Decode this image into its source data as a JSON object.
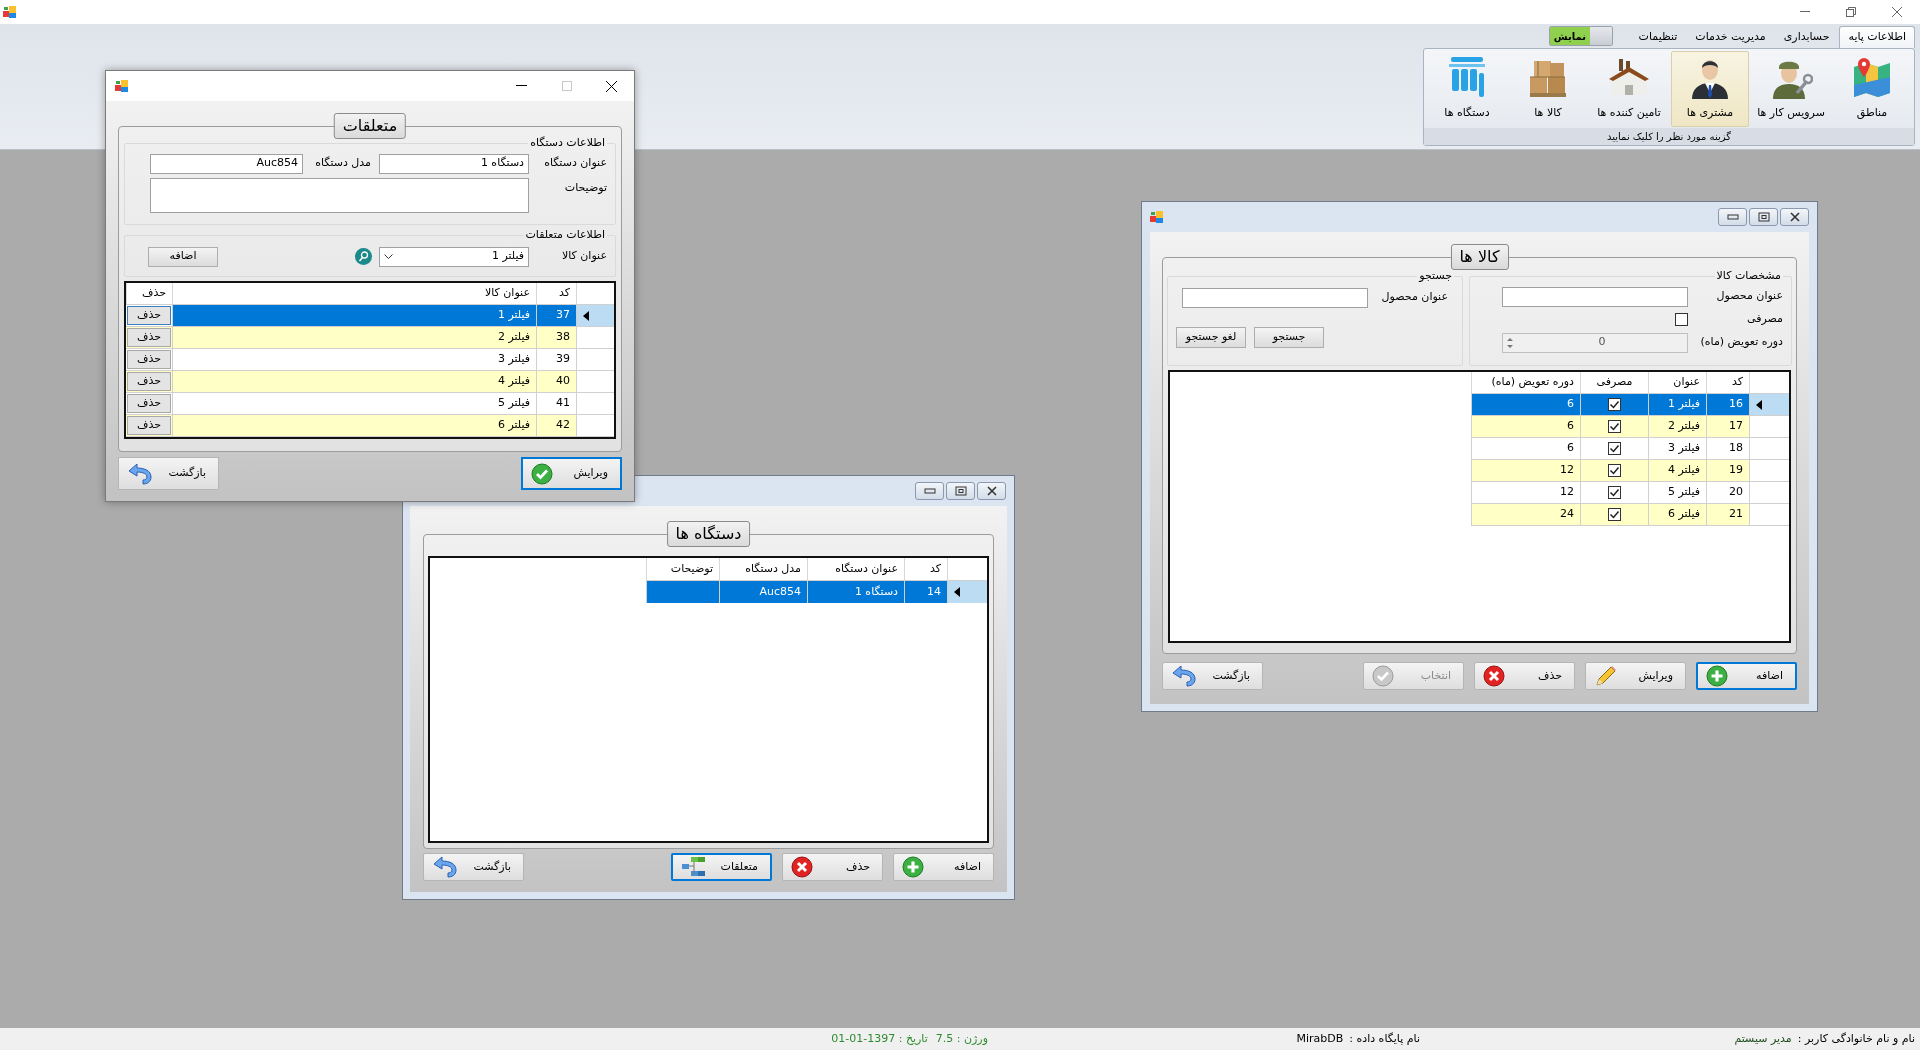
{
  "ribbon": {
    "tabs": [
      {
        "label": "اطلاعات پایه",
        "selected": true
      },
      {
        "label": "حسابداری",
        "selected": false
      },
      {
        "label": "مدیریت خدمات",
        "selected": false
      },
      {
        "label": "تنظیمات",
        "selected": false
      }
    ],
    "display_toggle": {
      "label": "نمایش",
      "on": true
    },
    "buttons": [
      {
        "label": "مناطق",
        "kind": "map",
        "selected": false
      },
      {
        "label": "سرویس کار ها",
        "kind": "worker",
        "selected": false
      },
      {
        "label": "مشتری ها",
        "kind": "customer",
        "selected": true
      },
      {
        "label": "تامین کننده ها",
        "kind": "supplier",
        "selected": false
      },
      {
        "label": "کالا ها",
        "kind": "goods",
        "selected": false
      },
      {
        "label": "دستگاه ها",
        "kind": "devices",
        "selected": false
      }
    ],
    "hint": "گزینه مورد نظر را کلیک نمایید"
  },
  "goods_window": {
    "title": "کالا ها",
    "specs": {
      "title": "مشخصات کالا",
      "name_label": "عنوان محصول",
      "consumable_label": "مصرفی",
      "consumable_checked": false,
      "period_label": "دوره تعویض (ماه)",
      "period_value": "0"
    },
    "search": {
      "title": "جستجو",
      "name_label": "عنوان محصول",
      "buttons": [
        "جستجو",
        "لغو جستجو"
      ]
    },
    "table": {
      "columns": [
        "کد",
        "عنوان",
        "مصرفی",
        "دوره تعویض (ماه)"
      ],
      "rows": [
        {
          "code": "16",
          "title": "فیلتر 1",
          "consumable": true,
          "period": "6",
          "selected": true
        },
        {
          "code": "17",
          "title": "فیلتر 2",
          "consumable": true,
          "period": "6",
          "selected": false
        },
        {
          "code": "18",
          "title": "فیلتر 3",
          "consumable": true,
          "period": "6",
          "selected": false
        },
        {
          "code": "19",
          "title": "فیلتر 4",
          "consumable": true,
          "period": "12",
          "selected": false
        },
        {
          "code": "20",
          "title": "فیلتر 5",
          "consumable": true,
          "period": "12",
          "selected": false
        },
        {
          "code": "21",
          "title": "فیلتر 6",
          "consumable": true,
          "period": "24",
          "selected": false
        }
      ]
    },
    "buttons": [
      {
        "label": "اضافه",
        "kind": "add",
        "focused": true,
        "disabled": false
      },
      {
        "label": "ویرایش",
        "kind": "edit",
        "focused": false,
        "disabled": false
      },
      {
        "label": "حذف",
        "kind": "delete",
        "focused": false,
        "disabled": false
      },
      {
        "label": "انتخاب",
        "kind": "select",
        "focused": false,
        "disabled": true
      },
      {
        "label": "بازگشت",
        "kind": "back",
        "focused": false,
        "disabled": false
      }
    ]
  },
  "devices_window": {
    "title": "دستگاه ها",
    "table": {
      "columns": [
        "کد",
        "عنوان دستگاه",
        "مدل دستگاه",
        "توضیحات"
      ],
      "rows": [
        {
          "code": "14",
          "title": "دستگاه 1",
          "model": "Auc854",
          "selected": true
        }
      ]
    },
    "buttons": [
      {
        "label": "اضافه",
        "kind": "add",
        "focused": false,
        "disabled": false
      },
      {
        "label": "حذف",
        "kind": "delete",
        "focused": false,
        "disabled": false
      },
      {
        "label": "متعلقات",
        "kind": "related",
        "focused": true,
        "disabled": false
      },
      {
        "label": "بازگشت",
        "kind": "back",
        "focused": false,
        "disabled": false
      }
    ]
  },
  "accessories_dialog": {
    "title": "متعلقات",
    "device_info": {
      "title": "اطلاعات دستگاه",
      "device_title_label": "عنوان دستگاه",
      "device_title": "دستگاه 1",
      "model_label": "مدل دستگاه",
      "model": "Auc854",
      "description_label": "توضیحات"
    },
    "accessory_info": {
      "title": "اطلاعات متعلقات",
      "item_label": "عنوان کالا",
      "item_value": "فیلتر 1",
      "add_button": "اضافه"
    },
    "table": {
      "columns": [
        "کد",
        "عنوان کالا",
        "حذف"
      ],
      "rows": [
        {
          "code": "37",
          "title": "فیلتر 1",
          "delete": "حذف",
          "selected": true
        },
        {
          "code": "38",
          "title": "فیلتر 2",
          "delete": "حذف",
          "selected": false
        },
        {
          "code": "39",
          "title": "فیلتر 3",
          "delete": "حذف",
          "selected": false
        },
        {
          "code": "40",
          "title": "فیلتر 4",
          "delete": "حذف",
          "selected": false
        },
        {
          "code": "41",
          "title": "فیلتر 5",
          "delete": "حذف",
          "selected": false
        },
        {
          "code": "42",
          "title": "فیلتر 6",
          "delete": "حذف",
          "selected": false
        }
      ]
    },
    "buttons": [
      {
        "label": "ویرایش",
        "kind": "confirm",
        "focused": true,
        "disabled": false
      },
      {
        "label": "بازگشت",
        "kind": "back",
        "focused": false,
        "disabled": false
      }
    ]
  },
  "status_bar": {
    "user_label": "نام و نام خانوادگی کاربر :",
    "user": "مدیر سیستم",
    "database_label": "نام پایگاه داده :",
    "database": "MirabDB",
    "version": "ورژن : 7.5",
    "date": "تاریخ : 1397-01-01"
  }
}
